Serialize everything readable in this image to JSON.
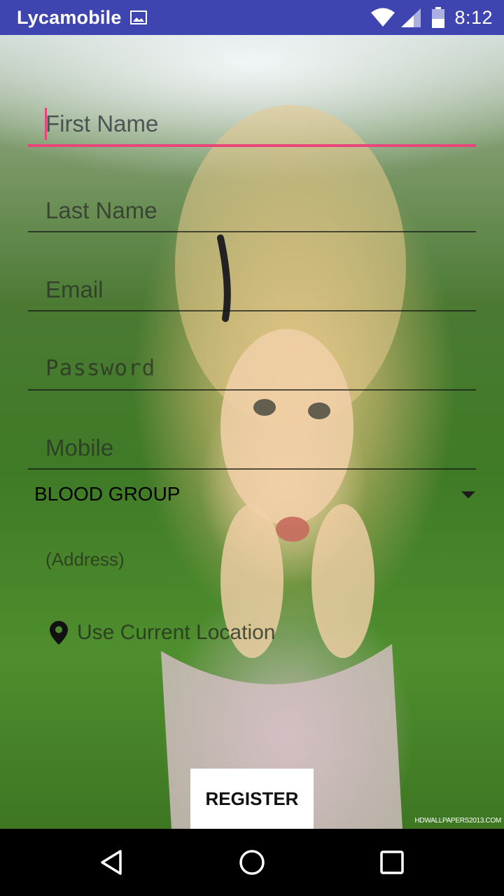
{
  "status_bar": {
    "carrier": "Lycamobile",
    "time": "8:12",
    "icons": [
      "gallery-icon",
      "wifi-icon",
      "cell-signal-icon",
      "battery-icon"
    ],
    "background_color": "#3f45b0"
  },
  "form": {
    "fields": [
      {
        "placeholder": "First Name",
        "focused": true
      },
      {
        "placeholder": "Last Name"
      },
      {
        "placeholder": "Email"
      },
      {
        "placeholder": "Password"
      },
      {
        "placeholder": "Mobile"
      }
    ],
    "blood_group": {
      "label": "BLOOD GROUP"
    },
    "address": {
      "placeholder": "(Address)"
    },
    "location": {
      "label": "Use Current Location",
      "icon": "location-pin-icon"
    },
    "register_label": "REGISTER",
    "accent_color": "#e8457a"
  },
  "background": {
    "watermark": "HDWALLPAPERS2013.COM"
  },
  "nav_bar": {
    "icons": [
      "back-icon",
      "home-icon",
      "recents-icon"
    ]
  }
}
